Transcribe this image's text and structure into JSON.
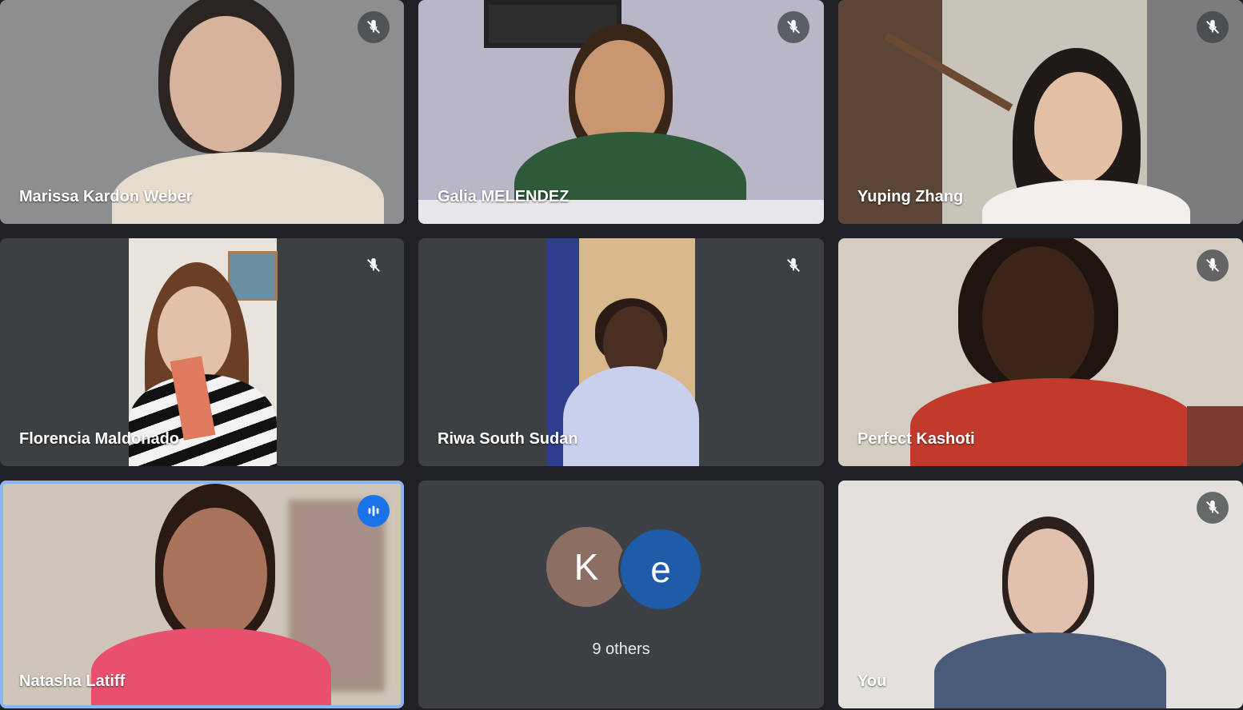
{
  "participants": [
    {
      "name": "Marissa Kardon Weber",
      "mic": "mic-off-icon"
    },
    {
      "name": "Galia MELENDEZ",
      "mic": "mic-off-icon"
    },
    {
      "name": "Yuping Zhang",
      "mic": "mic-off-icon"
    },
    {
      "name": "Florencia Maldonado",
      "mic": "mic-off-icon"
    },
    {
      "name": "Riwa South Sudan",
      "mic": "mic-off-icon"
    },
    {
      "name": "Perfect Kashoti",
      "mic": "mic-off-icon"
    },
    {
      "name": "Natasha Latiff",
      "mic": "speaking-indicator-icon"
    },
    {
      "name": "You",
      "mic": "mic-off-icon"
    }
  ],
  "others_tile": {
    "avatars": [
      {
        "letter": "K",
        "color": "#8d6e63"
      },
      {
        "letter": "e",
        "color": "#1e5ba8"
      }
    ],
    "label": "9 others"
  },
  "colors": {
    "speaking_outline": "#8ab4f8",
    "speaking_badge": "#1a73e8",
    "tile_background": "#3c4043",
    "page_background": "#202124"
  }
}
